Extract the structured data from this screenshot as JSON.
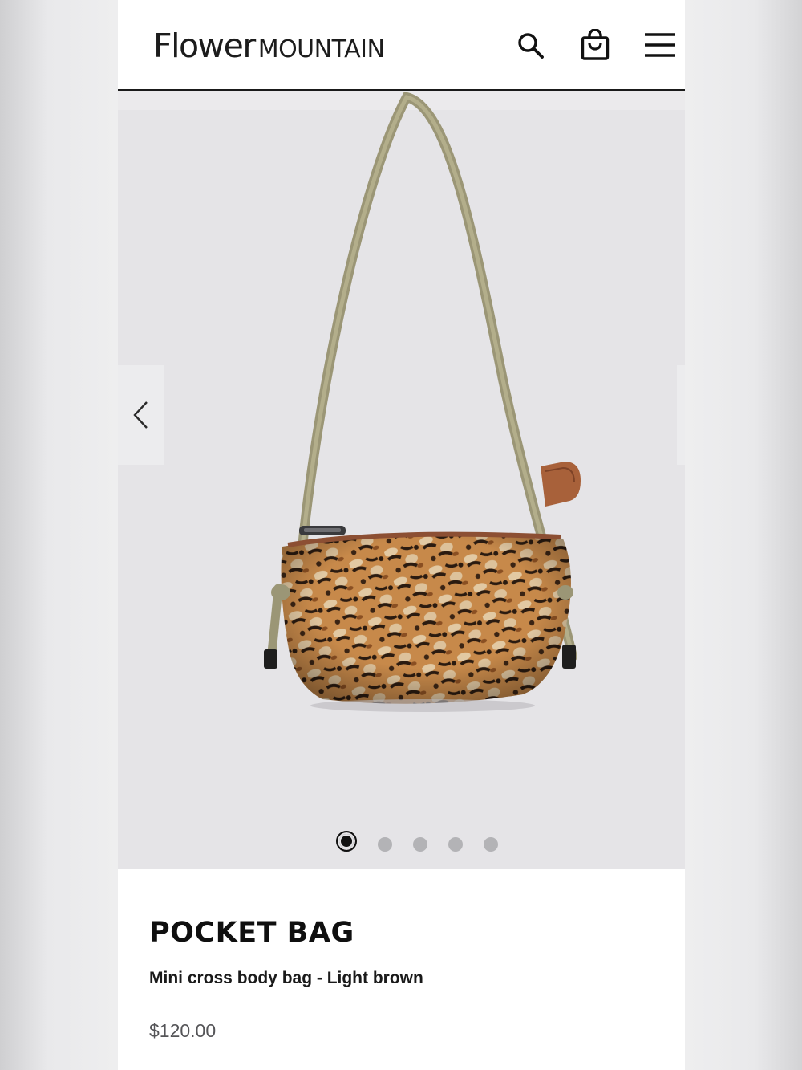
{
  "header": {
    "brand_part1": "Flower",
    "brand_part2": "MOUNTAIN",
    "icons": [
      "search-icon",
      "shopping-bag-icon",
      "menu-icon"
    ]
  },
  "gallery": {
    "slide_count": 5,
    "active_slide": 1,
    "image_subject": "product-photo"
  },
  "product": {
    "title": "POCKET BAG",
    "subtitle": "Mini cross body bag - Light brown",
    "price": "$120.00"
  },
  "colors": {
    "header_border": "#1a1a1a",
    "gallery_bg": "#e5e4e7",
    "dot_active": "#111111",
    "dot_inactive": "#b3b3b6",
    "price_text": "#555558"
  }
}
